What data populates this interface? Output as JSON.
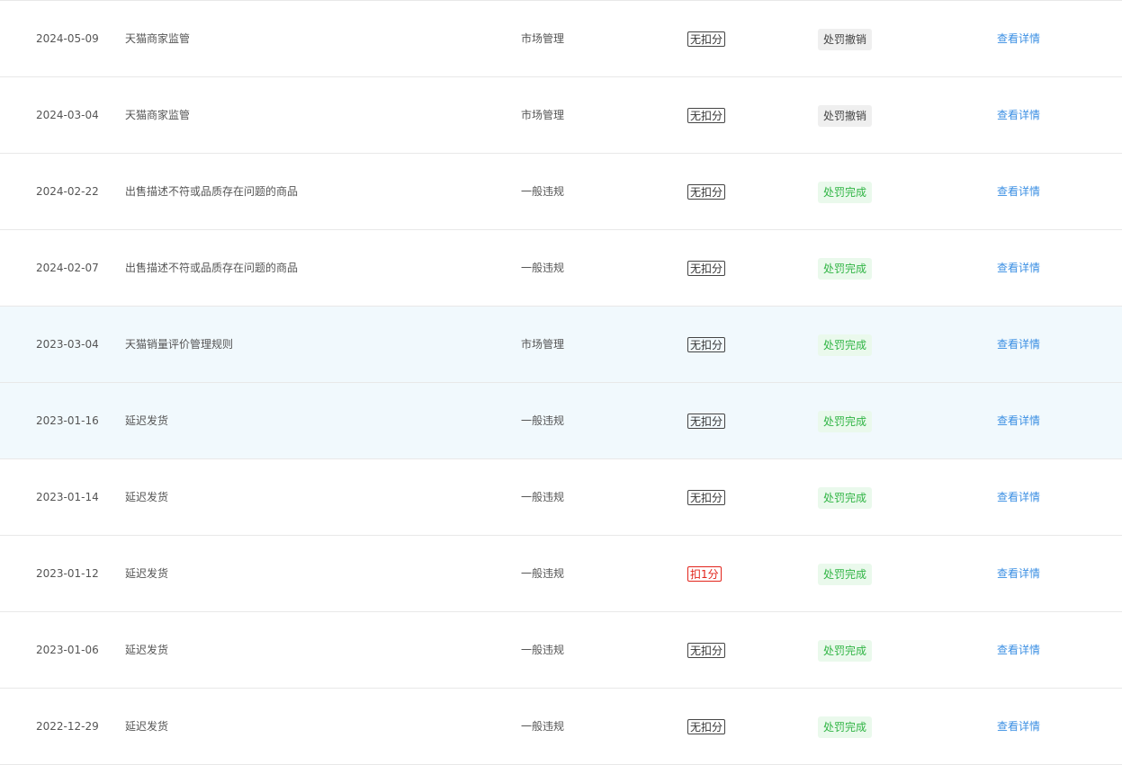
{
  "colors": {
    "link": "#3b8fe3",
    "status_done_bg": "#eaf9ec",
    "status_done_text": "#31b545",
    "status_revoked_bg": "#efefef",
    "deduct": "#e2231a",
    "highlight_row": "#f1f9fd"
  },
  "rows": [
    {
      "date": "2024-05-09",
      "reason": "天猫商家监管",
      "type": "市场管理",
      "points": "无扣分",
      "status": "处罚撤销",
      "action": "查看详情"
    },
    {
      "date": "2024-03-04",
      "reason": "天猫商家监管",
      "type": "市场管理",
      "points": "无扣分",
      "status": "处罚撤销",
      "action": "查看详情"
    },
    {
      "date": "2024-02-22",
      "reason": "出售描述不符或品质存在问题的商品",
      "type": "一般违规",
      "points": "无扣分",
      "status": "处罚完成",
      "action": "查看详情"
    },
    {
      "date": "2024-02-07",
      "reason": "出售描述不符或品质存在问题的商品",
      "type": "一般违规",
      "points": "无扣分",
      "status": "处罚完成",
      "action": "查看详情"
    },
    {
      "date": "2023-03-04",
      "reason": "天猫销量评价管理规则",
      "type": "市场管理",
      "points": "无扣分",
      "status": "处罚完成",
      "action": "查看详情"
    },
    {
      "date": "2023-01-16",
      "reason": "延迟发货",
      "type": "一般违规",
      "points": "无扣分",
      "status": "处罚完成",
      "action": "查看详情"
    },
    {
      "date": "2023-01-14",
      "reason": "延迟发货",
      "type": "一般违规",
      "points": "无扣分",
      "status": "处罚完成",
      "action": "查看详情"
    },
    {
      "date": "2023-01-12",
      "reason": "延迟发货",
      "type": "一般违规",
      "points": "扣1分",
      "status": "处罚完成",
      "action": "查看详情"
    },
    {
      "date": "2023-01-06",
      "reason": "延迟发货",
      "type": "一般违规",
      "points": "无扣分",
      "status": "处罚完成",
      "action": "查看详情"
    },
    {
      "date": "2022-12-29",
      "reason": "延迟发货",
      "type": "一般违规",
      "points": "无扣分",
      "status": "处罚完成",
      "action": "查看详情"
    }
  ]
}
